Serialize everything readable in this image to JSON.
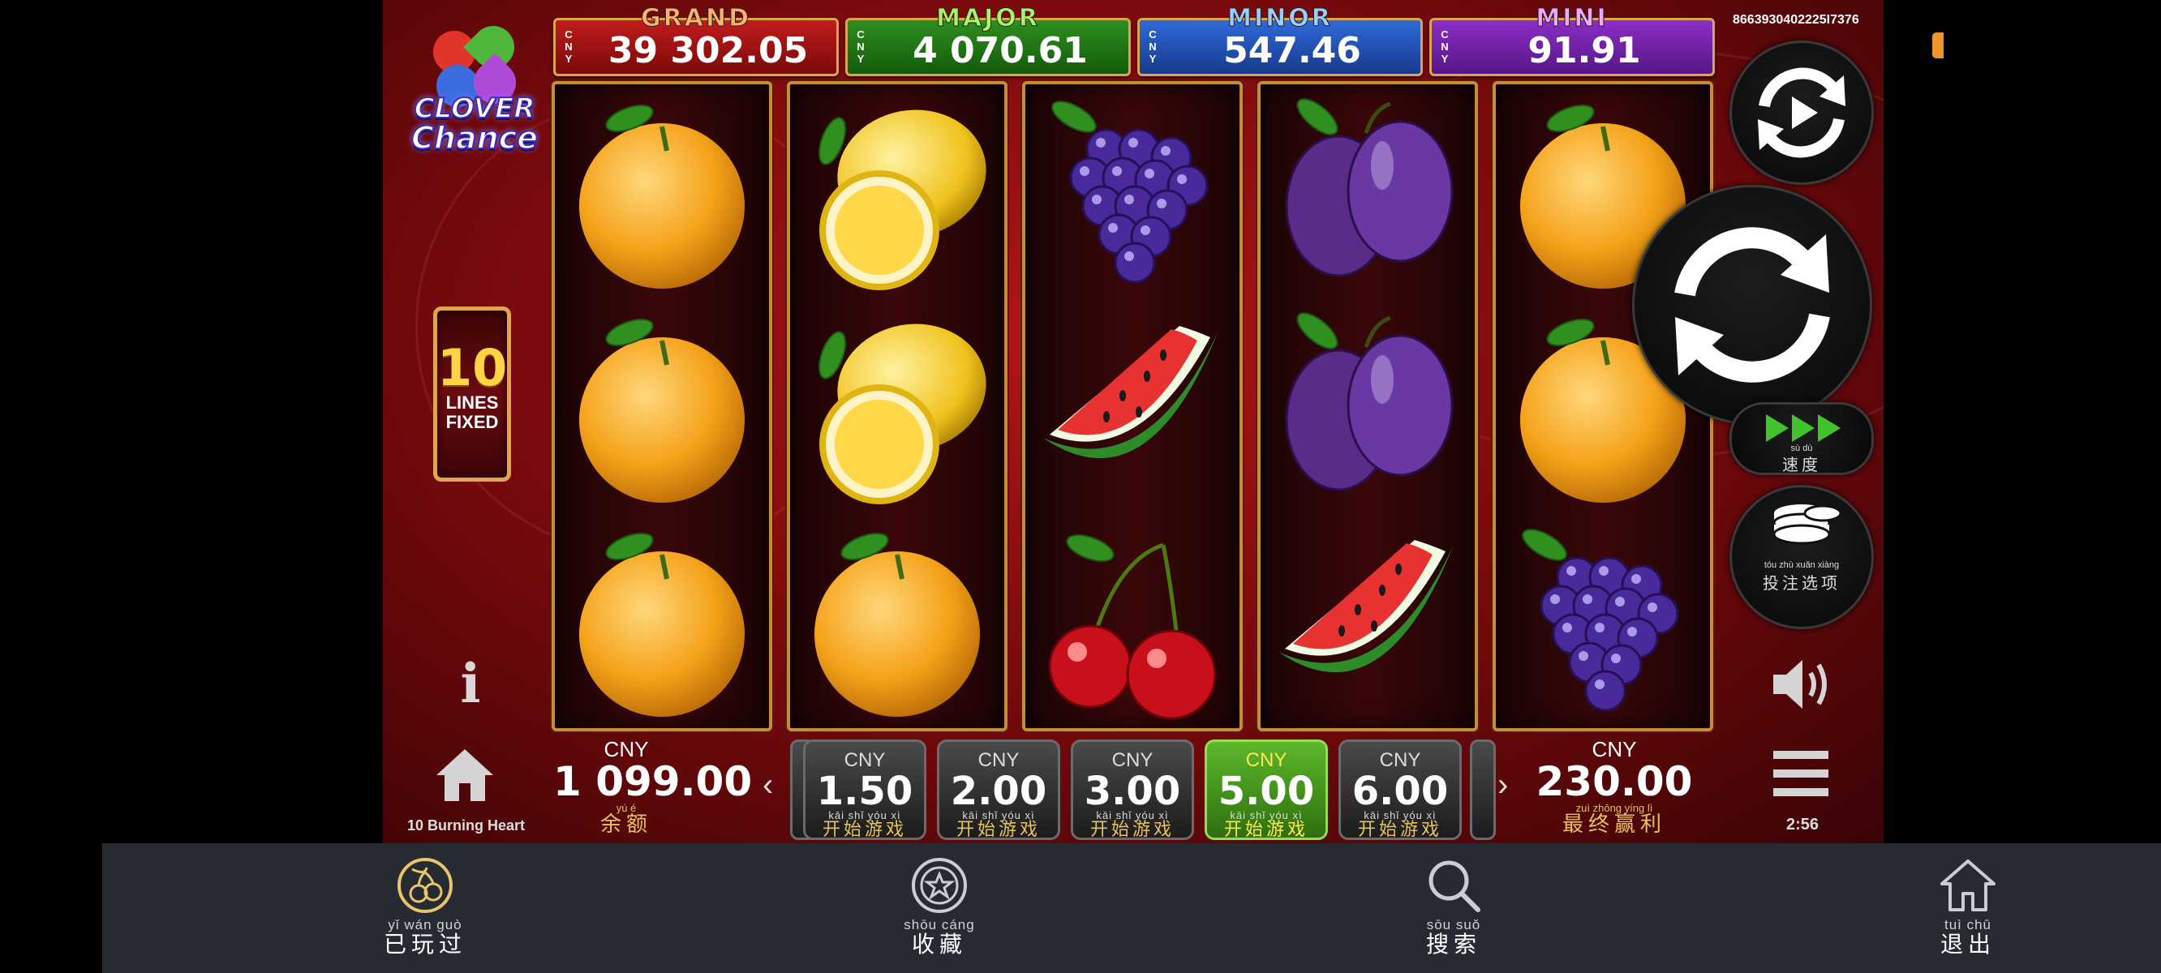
{
  "game": {
    "logo_line1": "CLOVER",
    "logo_line2": "Chance",
    "lines_number": "10",
    "lines_label1": "LINES",
    "lines_label2": "FIXED",
    "game_id": "8663930402225I7376",
    "game_name": "10 Burning Heart",
    "clock": "2:56"
  },
  "jackpots": [
    {
      "title": "GRAND",
      "currency": "CNY",
      "value": "39 302.05"
    },
    {
      "title": "MAJOR",
      "currency": "CNY",
      "value": "4 070.61"
    },
    {
      "title": "MINOR",
      "currency": "CNY",
      "value": "547.46"
    },
    {
      "title": "MINI",
      "currency": "CNY",
      "value": "91.91"
    }
  ],
  "reels": [
    [
      "orange",
      "orange",
      "orange"
    ],
    [
      "lemon",
      "lemon",
      "orange"
    ],
    [
      "grapes",
      "watermelon",
      "cherries"
    ],
    [
      "plum",
      "plum",
      "watermelon"
    ],
    [
      "orange",
      "orange",
      "grapes"
    ]
  ],
  "balance": {
    "currency": "CNY",
    "value": "1 099.00",
    "pinyin": "yú   é",
    "label": "余额"
  },
  "bets": [
    {
      "currency": "CNY",
      "amount": "1.50",
      "pinyin": "kāi  shǐ  yóu  xì",
      "label": "开始游戏",
      "active": false
    },
    {
      "currency": "CNY",
      "amount": "2.00",
      "pinyin": "kāi  shǐ  yóu  xì",
      "label": "开始游戏",
      "active": false
    },
    {
      "currency": "CNY",
      "amount": "3.00",
      "pinyin": "kāi  shǐ  yóu  xì",
      "label": "开始游戏",
      "active": false
    },
    {
      "currency": "CNY",
      "amount": "5.00",
      "pinyin": "kāi  shǐ  yóu  xì",
      "label": "开始游戏",
      "active": true
    },
    {
      "currency": "CNY",
      "amount": "6.00",
      "pinyin": "kāi  shǐ  yóu  xì",
      "label": "开始游戏",
      "active": false
    }
  ],
  "win": {
    "currency": "CNY",
    "value": "230.00",
    "pinyin": "zuì zhōng yíng  lì",
    "label": "最终赢利"
  },
  "controls": {
    "speed_pinyin": "sù   dù",
    "speed_label": "速度",
    "bet_options_pinyin": "tóu   zhù  xuǎn xiàng",
    "bet_options_label": "投注选项",
    "info_glyph": "i"
  },
  "nav": [
    {
      "pinyin": "yǐ    wán guò",
      "label": "已玩过",
      "icon": "cherries-icon"
    },
    {
      "pinyin": "shōu cáng",
      "label": "收藏",
      "icon": "star-icon"
    },
    {
      "pinyin": "sōu   suǒ",
      "label": "搜索",
      "icon": "search-icon"
    },
    {
      "pinyin": "tuì    chū",
      "label": "退出",
      "icon": "home-icon"
    }
  ],
  "colors": {
    "active_bet": "#5cb82a",
    "gold_text": "#e8c25a",
    "nav_bg": "#262b33",
    "grand": "#c11c1c",
    "major": "#2d8f1e",
    "minor": "#2f6ad9",
    "mini": "#8b2ec8"
  }
}
